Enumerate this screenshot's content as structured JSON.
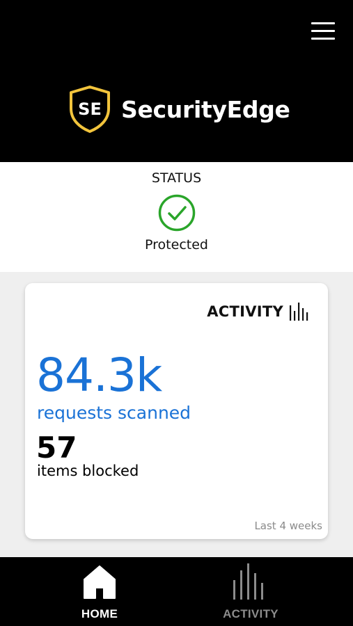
{
  "header": {
    "brand_name": "SecurityEdge",
    "logo_text": "SE"
  },
  "status": {
    "title": "STATUS",
    "value": "Protected",
    "icon": "check-circle-icon",
    "color": "#2aa52a"
  },
  "activity_card": {
    "title": "ACTIVITY",
    "requests_value": "84.3k",
    "requests_label": "requests scanned",
    "blocked_value": "57",
    "blocked_label": "items blocked",
    "period": "Last 4 weeks",
    "accent_color": "#1a72d6"
  },
  "bottom_nav": {
    "items": [
      {
        "label": "HOME",
        "icon": "home-icon",
        "active": true
      },
      {
        "label": "ACTIVITY",
        "icon": "activity-bars-icon",
        "active": false
      }
    ]
  },
  "colors": {
    "logo_gold": "#f2c43c",
    "nav_active": "#ffffff",
    "nav_inactive": "#8c8c8c"
  }
}
